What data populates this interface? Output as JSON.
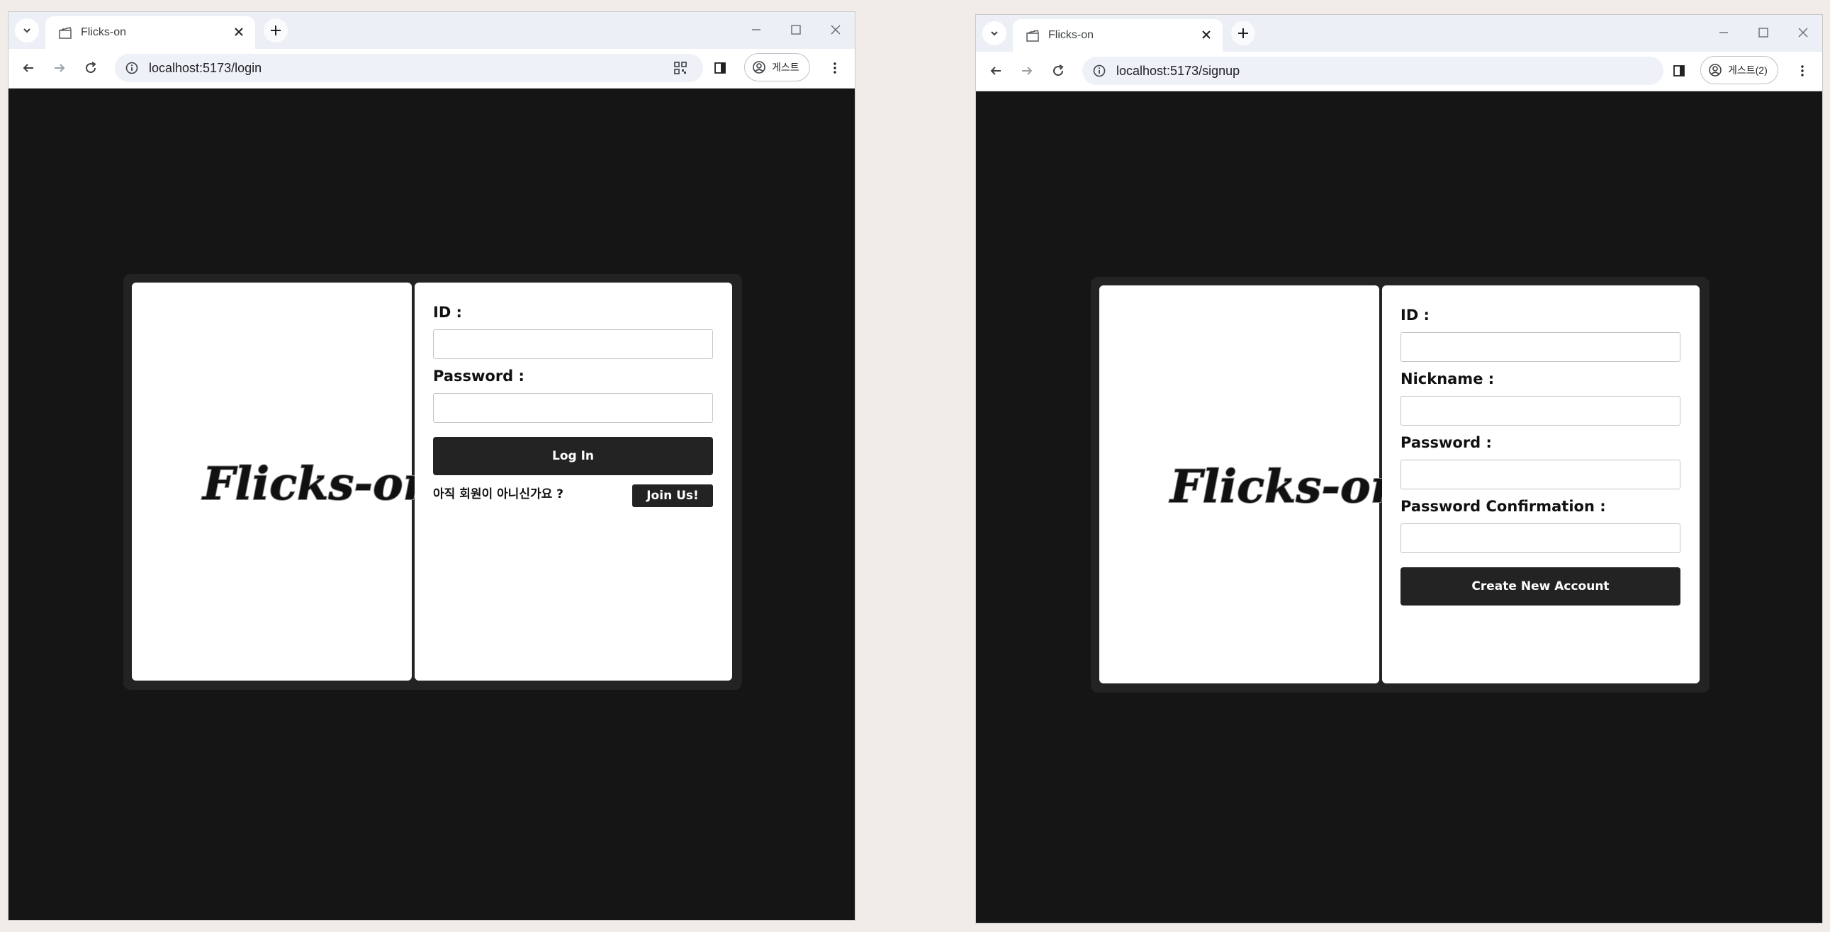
{
  "login_window": {
    "tab_title": "Flicks-on",
    "url": "localhost:5173/login",
    "profile_label": "게스트",
    "logo_text": "Flicks-on",
    "form": {
      "id_label": "ID :",
      "id_value": "",
      "password_label": "Password :",
      "password_value": "",
      "login_button": "Log In",
      "signup_prompt": "아직 회원이 아니신가요 ?",
      "join_button": "Join Us!"
    }
  },
  "signup_window": {
    "tab_title": "Flicks-on",
    "url": "localhost:5173/signup",
    "profile_label": "게스트(2)",
    "logo_text": "Flicks-on",
    "form": {
      "id_label": "ID :",
      "id_value": "",
      "nickname_label": "Nickname :",
      "nickname_value": "",
      "password_label": "Password :",
      "password_value": "",
      "password_confirm_label": "Password Confirmation :",
      "password_confirm_value": "",
      "create_button": "Create New Account"
    }
  },
  "colors": {
    "page_bg": "#151515",
    "frame": "#232323",
    "panel": "#ffffff",
    "button": "#232323",
    "desktop": "#f1ece7"
  },
  "icons": [
    "tab-search-icon",
    "clapperboard-icon",
    "close-icon",
    "plus-icon",
    "minimize-icon",
    "maximize-icon",
    "back-icon",
    "forward-icon",
    "reload-icon",
    "info-icon",
    "qr-code-icon",
    "side-panel-icon",
    "profile-icon",
    "kebab-menu-icon"
  ]
}
